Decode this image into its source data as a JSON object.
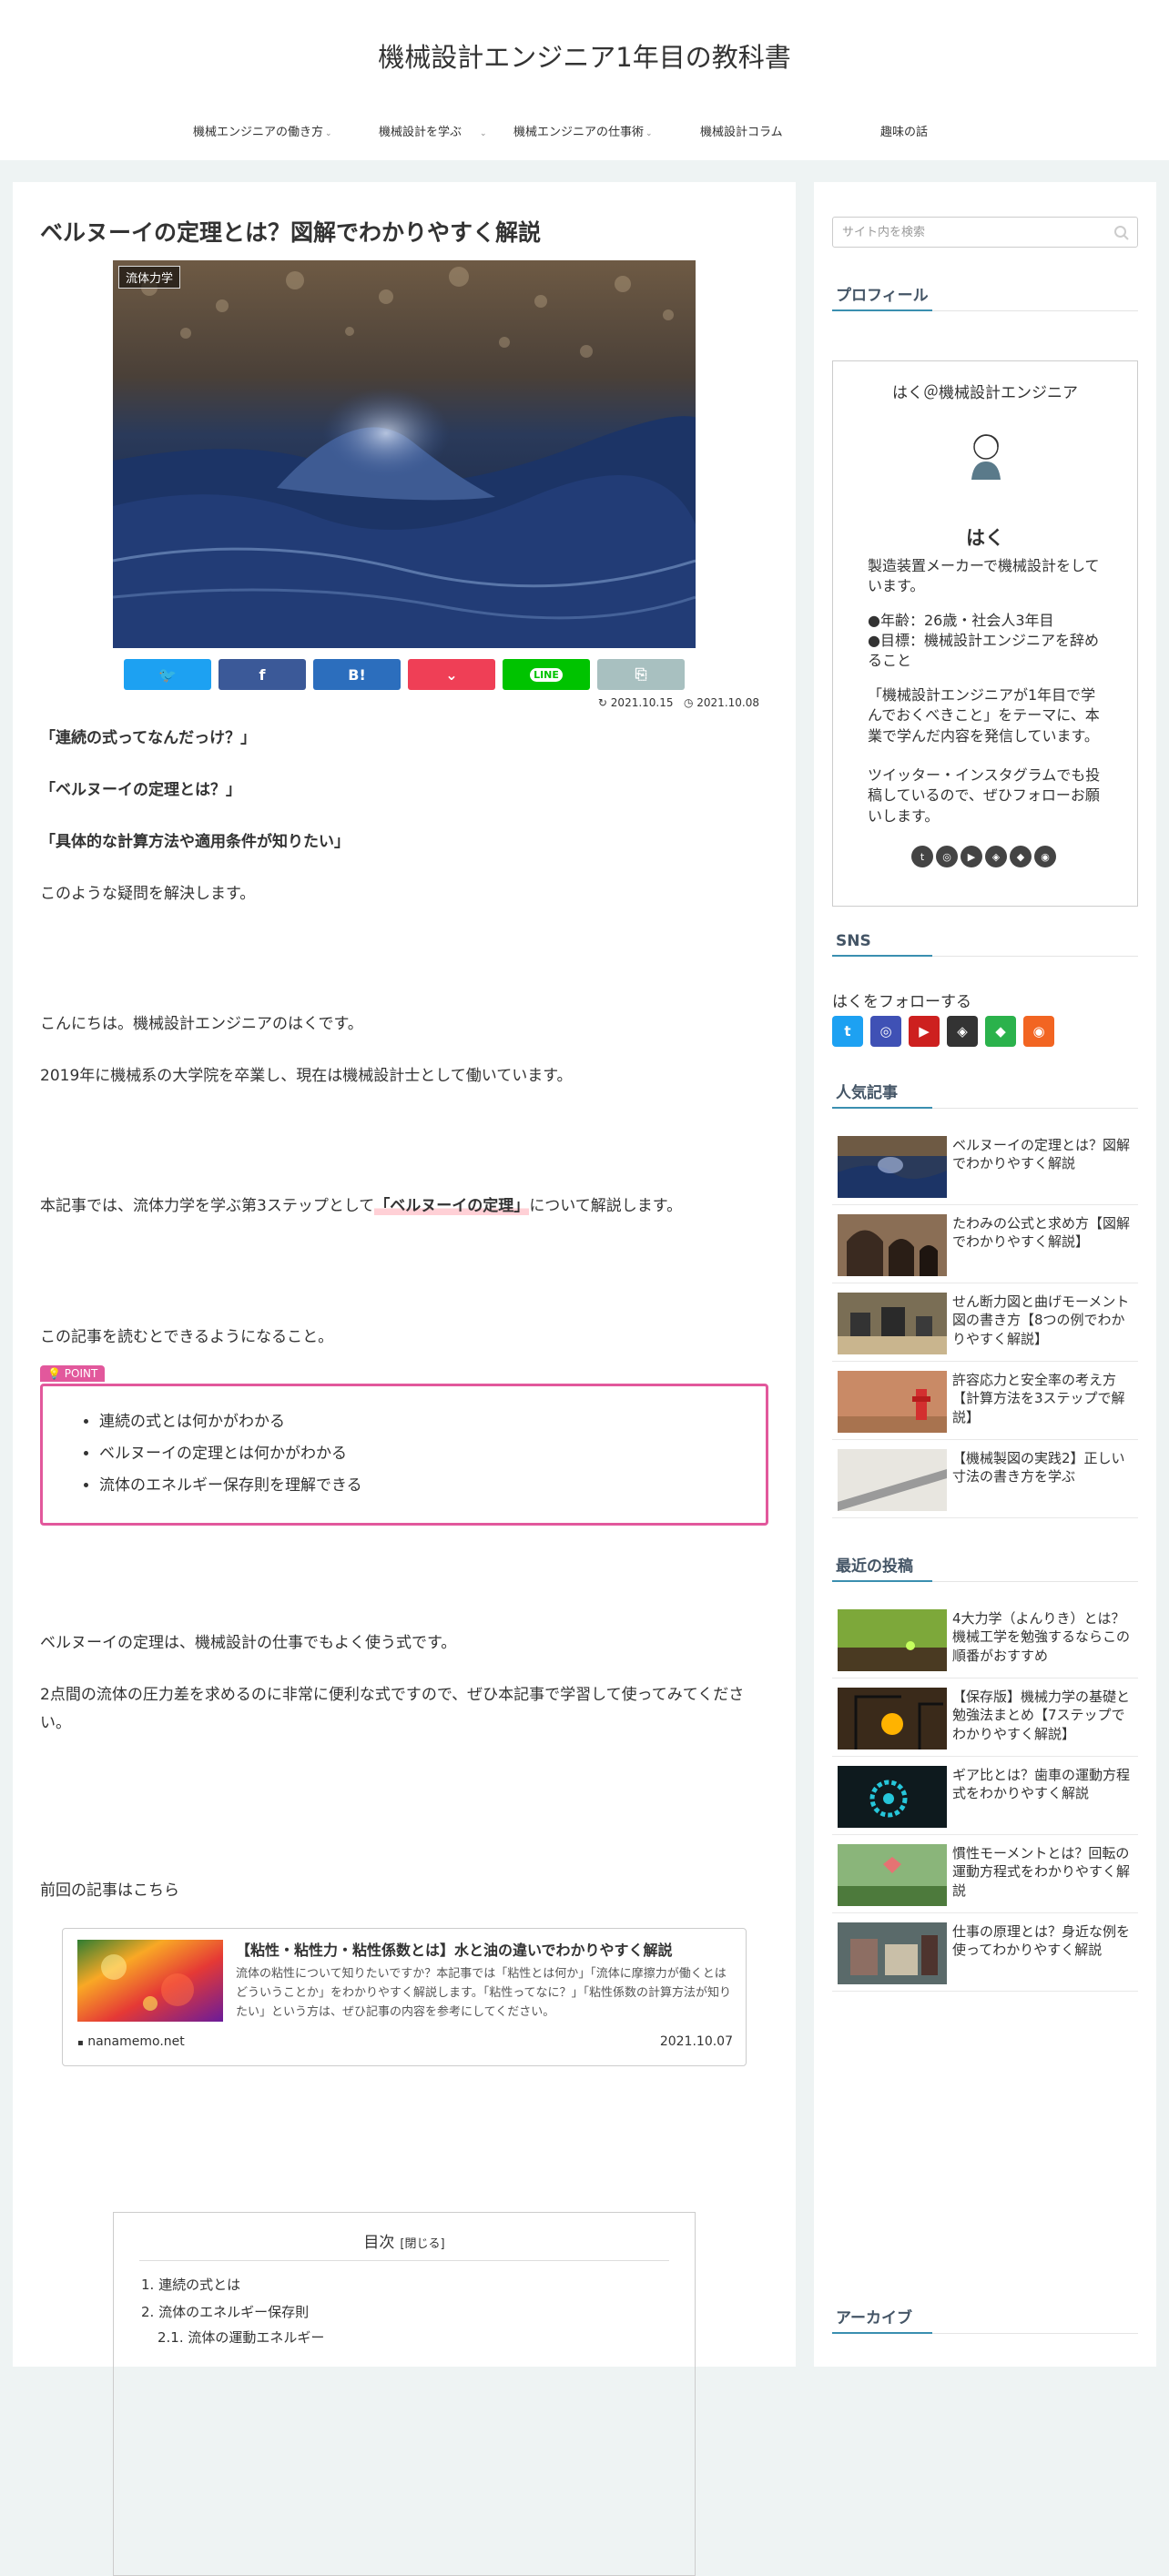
{
  "header": {
    "site_title": "機械設計エンジニア1年目の教科書",
    "nav": [
      {
        "label": "機械エンジニアの働き方"
      },
      {
        "label": "機械設計を学ぶ"
      },
      {
        "label": "機械エンジニアの仕事術"
      },
      {
        "label": "機械設計コラム"
      },
      {
        "label": "趣味の話"
      }
    ]
  },
  "article": {
    "title": "ベルヌーイの定理とは？図解でわかりやすく解説",
    "category": "流体力学",
    "share": [
      {
        "icon": "twitter-icon",
        "glyph": "🐦",
        "color": "#1da1f2"
      },
      {
        "icon": "facebook-icon",
        "glyph": "f",
        "color": "#3b5998"
      },
      {
        "icon": "hatena-icon",
        "glyph": "B!",
        "color": "#2c6ebd"
      },
      {
        "icon": "pocket-icon",
        "glyph": "⌄",
        "color": "#ef3f56"
      },
      {
        "icon": "line-icon",
        "glyph": "LINE",
        "color": "#00c300"
      },
      {
        "icon": "copy-icon",
        "glyph": "⎘",
        "color": "#a8c0c0"
      }
    ],
    "updated_date": "2021.10.15",
    "posted_date": "2021.10.08",
    "q1": "「連続の式ってなんだっけ？」",
    "q2": "「ベルヌーイの定理とは？」",
    "q3": "「具体的な計算方法や適用条件が知りたい」",
    "solve": "このような疑問を解決します。",
    "greet": "こんにちは。機械設計エンジニアのはくです。",
    "bio": "2019年に機械系の大学院を卒業し、現在は機械設計士として働いています。",
    "intro_pre": "本記事では、流体力学を学ぶ第3ステップとして",
    "intro_mark": "「ベルヌーイの定理」",
    "intro_post": "について解説します。",
    "can_do": "この記事を読むとできるようになること。",
    "point_label": "POINT",
    "points": [
      "連続の式とは何かがわかる",
      "ベルヌーイの定理とは何かがわかる",
      "流体のエネルギー保存則を理解できる"
    ],
    "usage": "ベルヌーイの定理は、機械設計の仕事でもよく使う式です。",
    "usage2": "2点間の流体の圧力差を求めるのに非常に便利な式ですので、ぜひ本記事で学習して使ってみてください。",
    "prev": "前回の記事はこちら",
    "blogcard": {
      "title": "【粘性・粘性力・粘性係数とは】水と油の違いでわかりやすく解説",
      "text": "流体の粘性について知りたいですか？本記事では「粘性とは何か」「流体に摩擦力が働くとはどういうことか」をわかりやすく解説します。「粘性ってなに？」「粘性係数の計算方法が知りたい」という方は、ぜひ記事の内容を参考にしてください。",
      "site": "nanamemo.net",
      "date": "2021.10.07"
    },
    "toc": {
      "title": "目次",
      "toggle": "[閉じる]",
      "items": [
        "1. 連続の式とは",
        "2. 流体のエネルギー保存則",
        "2.1. 流体の運動エネルギー"
      ]
    }
  },
  "sidebar": {
    "search_placeholder": "サイト内を検索",
    "profile_title": "プロフィール",
    "profile": {
      "name": "はく＠機械設計エンジニア",
      "handle": "はく",
      "text1": "製造装置メーカーで機械設計をしています。",
      "age": "●年齢：26歳・社会人3年目",
      "goal": "●目標：機械設計エンジニアを辞めること",
      "text2": "「機械設計エンジニアが1年目で学んでおくべきこと」をテーマに、本業で学んだ内容を発信しています。",
      "text3": "ツイッター・インスタグラムでも投稿しているので、ぜひフォローお願いします。"
    },
    "sns_title": "SNS",
    "follow_text": "はくをフォローする",
    "follow_icons": [
      {
        "icon": "twitter-icon",
        "glyph": "t",
        "color": "#1da1f2"
      },
      {
        "icon": "instagram-icon",
        "glyph": "◎",
        "color": "#3f51b5"
      },
      {
        "icon": "youtube-icon",
        "glyph": "▶",
        "color": "#cd201f"
      },
      {
        "icon": "codepen-icon",
        "glyph": "◈",
        "color": "#333333"
      },
      {
        "icon": "feedly-icon",
        "glyph": "◆",
        "color": "#2bb24c"
      },
      {
        "icon": "rss-icon",
        "glyph": "◉",
        "color": "#f26522"
      }
    ],
    "popular_title": "人気記事",
    "popular": [
      {
        "title": "ベルヌーイの定理とは？図解でわかりやすく解説"
      },
      {
        "title": "たわみの公式と求め方【図解でわかりやすく解説】"
      },
      {
        "title": "せん断力図と曲げモーメント図の書き方【8つの例でわかりやすく解説】"
      },
      {
        "title": "許容応力と安全率の考え方【計算方法を3ステップで解説】"
      },
      {
        "title": "【機械製図の実践2】正しい寸法の書き方を学ぶ"
      }
    ],
    "recent_title": "最近の投稿",
    "recent": [
      {
        "title": "4大力学（よんりき）とは？機械工学を勉強するならこの順番がおすすめ"
      },
      {
        "title": "【保存版】機械力学の基礎と勉強法まとめ【7ステップでわかりやすく解説】"
      },
      {
        "title": "ギア比とは？歯車の運動方程式をわかりやすく解説"
      },
      {
        "title": "慣性モーメントとは？回転の運動方程式をわかりやすく解説"
      },
      {
        "title": "仕事の原理とは？身近な例を使ってわかりやすく解説"
      }
    ],
    "archive_title": "アーカイブ"
  }
}
